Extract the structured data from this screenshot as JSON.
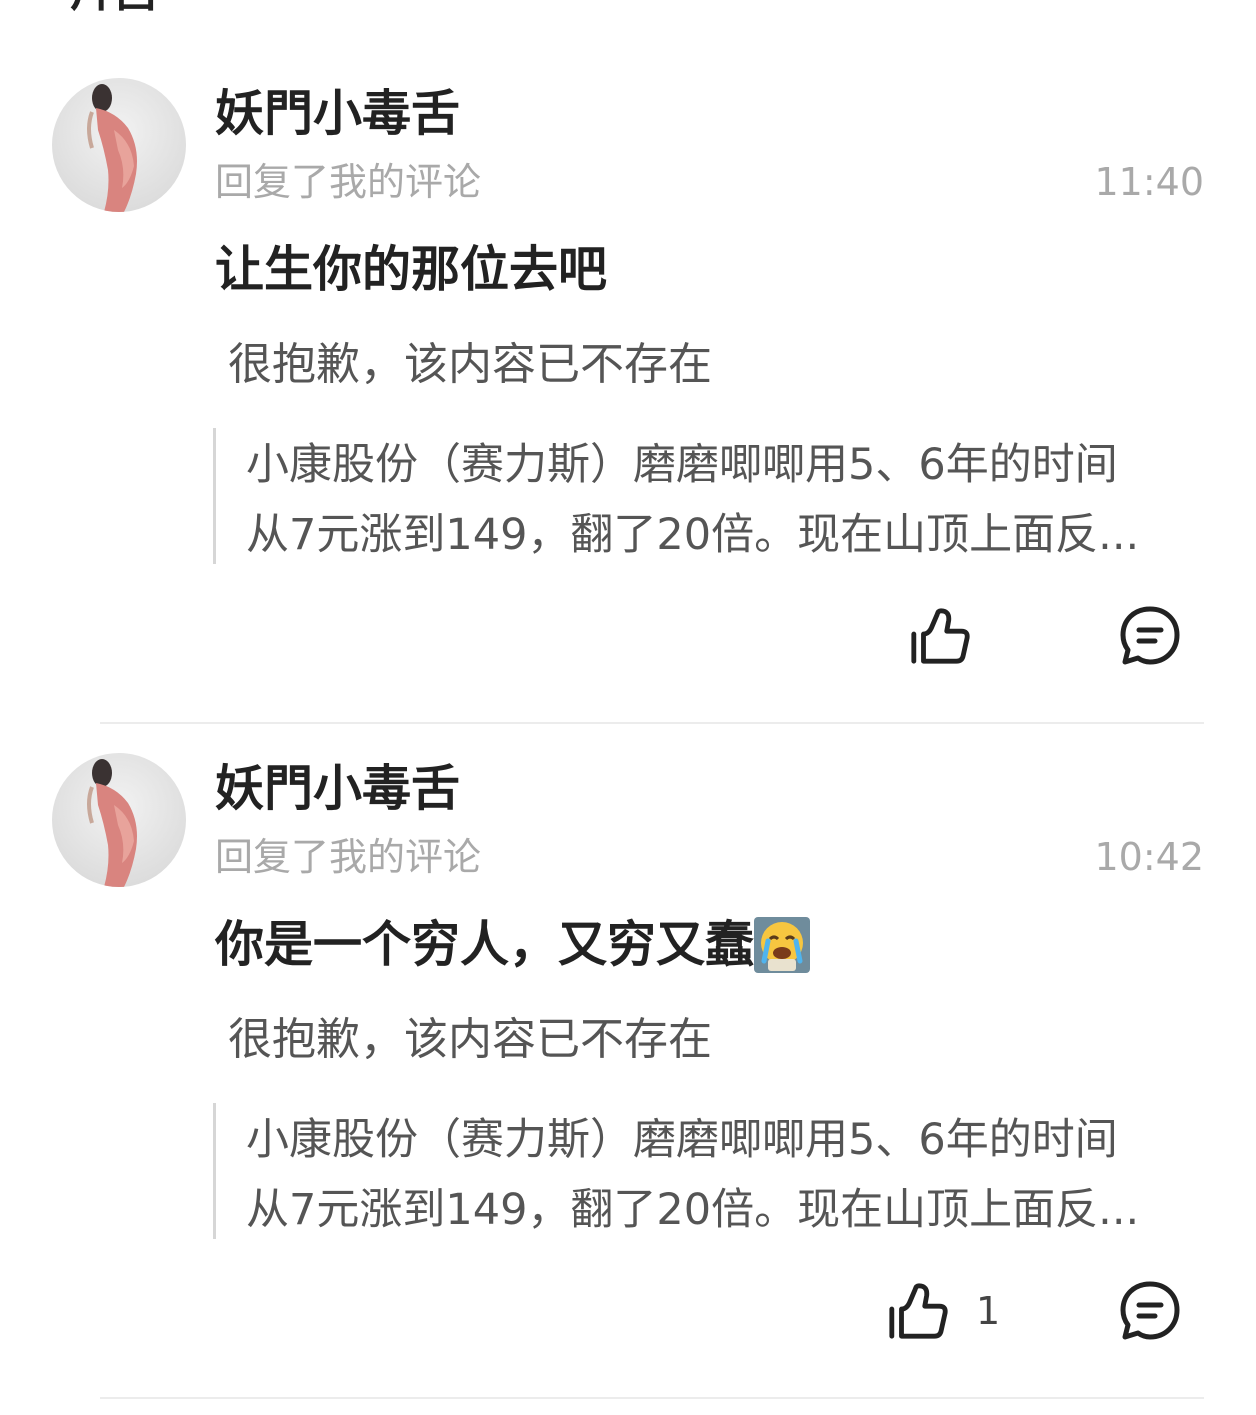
{
  "top_fragment": "片吕",
  "comments": [
    {
      "username": "妖門小毒舌",
      "action": "回复了我的评论",
      "time": "11:40",
      "reply": "让生你的那位去吧",
      "emoji": "",
      "deleted_notice": "很抱歉，该内容已不存在",
      "quote_line1": "小康股份（赛力斯）磨磨唧唧用5、6年的时间",
      "quote_line2": "从7元涨到149，翻了20倍。现在山顶上面反...",
      "like_count": "",
      "like_icon": "thumbs-up-icon",
      "comment_icon": "comment-icon"
    },
    {
      "username": "妖門小毒舌",
      "action": "回复了我的评论",
      "time": "10:42",
      "reply": "你是一个穷人，又穷又蠢",
      "emoji": "crying-emoji",
      "deleted_notice": "很抱歉，该内容已不存在",
      "quote_line1": "小康股份（赛力斯）磨磨唧唧用5、6年的时间",
      "quote_line2": "从7元涨到149，翻了20倍。现在山顶上面反...",
      "like_count": "1",
      "like_icon": "thumbs-up-icon",
      "comment_icon": "comment-icon"
    }
  ]
}
